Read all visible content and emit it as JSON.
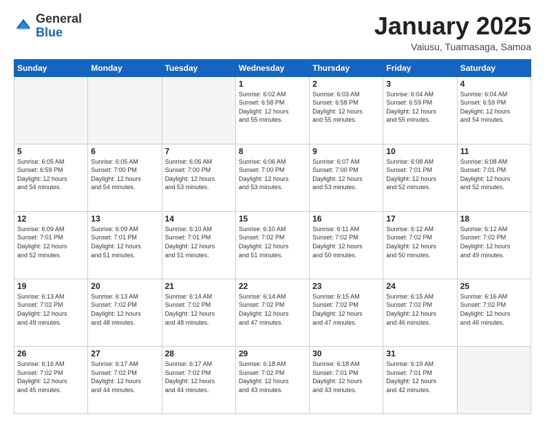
{
  "header": {
    "logo_general": "General",
    "logo_blue": "Blue",
    "title": "January 2025",
    "subtitle": "Vaiusu, Tuamasaga, Samoa"
  },
  "weekdays": [
    "Sunday",
    "Monday",
    "Tuesday",
    "Wednesday",
    "Thursday",
    "Friday",
    "Saturday"
  ],
  "weeks": [
    [
      {
        "day": "",
        "info": "",
        "empty": true
      },
      {
        "day": "",
        "info": "",
        "empty": true
      },
      {
        "day": "",
        "info": "",
        "empty": true
      },
      {
        "day": "1",
        "info": "Sunrise: 6:02 AM\nSunset: 6:58 PM\nDaylight: 12 hours\nand 55 minutes."
      },
      {
        "day": "2",
        "info": "Sunrise: 6:03 AM\nSunset: 6:58 PM\nDaylight: 12 hours\nand 55 minutes."
      },
      {
        "day": "3",
        "info": "Sunrise: 6:04 AM\nSunset: 6:59 PM\nDaylight: 12 hours\nand 55 minutes."
      },
      {
        "day": "4",
        "info": "Sunrise: 6:04 AM\nSunset: 6:59 PM\nDaylight: 12 hours\nand 54 minutes."
      }
    ],
    [
      {
        "day": "5",
        "info": "Sunrise: 6:05 AM\nSunset: 6:59 PM\nDaylight: 12 hours\nand 54 minutes."
      },
      {
        "day": "6",
        "info": "Sunrise: 6:05 AM\nSunset: 7:00 PM\nDaylight: 12 hours\nand 54 minutes."
      },
      {
        "day": "7",
        "info": "Sunrise: 6:06 AM\nSunset: 7:00 PM\nDaylight: 12 hours\nand 53 minutes."
      },
      {
        "day": "8",
        "info": "Sunrise: 6:06 AM\nSunset: 7:00 PM\nDaylight: 12 hours\nand 53 minutes."
      },
      {
        "day": "9",
        "info": "Sunrise: 6:07 AM\nSunset: 7:00 PM\nDaylight: 12 hours\nand 53 minutes."
      },
      {
        "day": "10",
        "info": "Sunrise: 6:08 AM\nSunset: 7:01 PM\nDaylight: 12 hours\nand 52 minutes."
      },
      {
        "day": "11",
        "info": "Sunrise: 6:08 AM\nSunset: 7:01 PM\nDaylight: 12 hours\nand 52 minutes."
      }
    ],
    [
      {
        "day": "12",
        "info": "Sunrise: 6:09 AM\nSunset: 7:01 PM\nDaylight: 12 hours\nand 52 minutes."
      },
      {
        "day": "13",
        "info": "Sunrise: 6:09 AM\nSunset: 7:01 PM\nDaylight: 12 hours\nand 51 minutes."
      },
      {
        "day": "14",
        "info": "Sunrise: 6:10 AM\nSunset: 7:01 PM\nDaylight: 12 hours\nand 51 minutes."
      },
      {
        "day": "15",
        "info": "Sunrise: 6:10 AM\nSunset: 7:02 PM\nDaylight: 12 hours\nand 51 minutes."
      },
      {
        "day": "16",
        "info": "Sunrise: 6:11 AM\nSunset: 7:02 PM\nDaylight: 12 hours\nand 50 minutes."
      },
      {
        "day": "17",
        "info": "Sunrise: 6:12 AM\nSunset: 7:02 PM\nDaylight: 12 hours\nand 50 minutes."
      },
      {
        "day": "18",
        "info": "Sunrise: 6:12 AM\nSunset: 7:02 PM\nDaylight: 12 hours\nand 49 minutes."
      }
    ],
    [
      {
        "day": "19",
        "info": "Sunrise: 6:13 AM\nSunset: 7:02 PM\nDaylight: 12 hours\nand 49 minutes."
      },
      {
        "day": "20",
        "info": "Sunrise: 6:13 AM\nSunset: 7:02 PM\nDaylight: 12 hours\nand 48 minutes."
      },
      {
        "day": "21",
        "info": "Sunrise: 6:14 AM\nSunset: 7:02 PM\nDaylight: 12 hours\nand 48 minutes."
      },
      {
        "day": "22",
        "info": "Sunrise: 6:14 AM\nSunset: 7:02 PM\nDaylight: 12 hours\nand 47 minutes."
      },
      {
        "day": "23",
        "info": "Sunrise: 6:15 AM\nSunset: 7:02 PM\nDaylight: 12 hours\nand 47 minutes."
      },
      {
        "day": "24",
        "info": "Sunrise: 6:15 AM\nSunset: 7:02 PM\nDaylight: 12 hours\nand 46 minutes."
      },
      {
        "day": "25",
        "info": "Sunrise: 6:16 AM\nSunset: 7:02 PM\nDaylight: 12 hours\nand 46 minutes."
      }
    ],
    [
      {
        "day": "26",
        "info": "Sunrise: 6:16 AM\nSunset: 7:02 PM\nDaylight: 12 hours\nand 45 minutes."
      },
      {
        "day": "27",
        "info": "Sunrise: 6:17 AM\nSunset: 7:02 PM\nDaylight: 12 hours\nand 44 minutes."
      },
      {
        "day": "28",
        "info": "Sunrise: 6:17 AM\nSunset: 7:02 PM\nDaylight: 12 hours\nand 44 minutes."
      },
      {
        "day": "29",
        "info": "Sunrise: 6:18 AM\nSunset: 7:02 PM\nDaylight: 12 hours\nand 43 minutes."
      },
      {
        "day": "30",
        "info": "Sunrise: 6:18 AM\nSunset: 7:01 PM\nDaylight: 12 hours\nand 43 minutes."
      },
      {
        "day": "31",
        "info": "Sunrise: 6:19 AM\nSunset: 7:01 PM\nDaylight: 12 hours\nand 42 minutes."
      },
      {
        "day": "",
        "info": "",
        "empty": true
      }
    ]
  ]
}
